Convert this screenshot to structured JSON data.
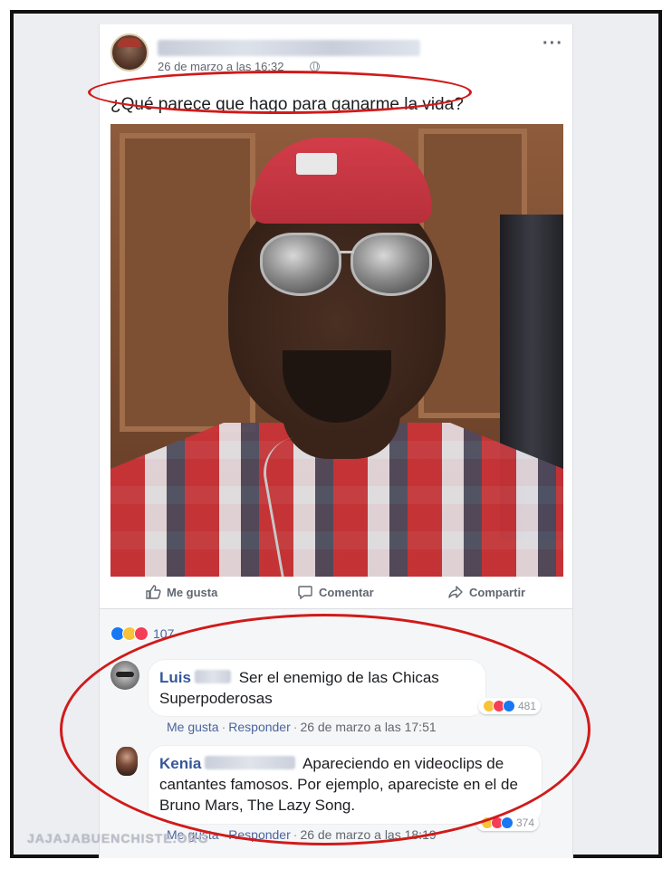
{
  "post": {
    "timestamp": "26 de marzo a las 16:32",
    "text": "¿Qué parece que hago para ganarme la vida?"
  },
  "actions": {
    "like_label": "Me gusta",
    "comment_label": "Comentar",
    "share_label": "Compartir"
  },
  "reactions": {
    "icons": [
      "like-icon",
      "haha-icon",
      "love-icon"
    ],
    "count": "107"
  },
  "comments": [
    {
      "name": "Luis",
      "text": "Ser el enemigo de las Chicas Superpoderosas",
      "like_label": "Me gusta",
      "reply_label": "Responder",
      "time": "26 de marzo a las 17:51",
      "reaction_count": "481"
    },
    {
      "name": "Kenia",
      "text": "Apareciendo en videoclips de cantantes famosos. Por ejemplo, apareciste en el de Bruno Mars, The Lazy Song.",
      "like_label": "Me gusta",
      "reply_label": "Responder",
      "time": "26 de marzo a las 18:19",
      "reaction_count": "374"
    }
  ],
  "watermark": "JAJAJABUENCHISTE.ORG",
  "colors": {
    "annotation": "#d11a1a",
    "link": "#365899",
    "like_blue": "#1877f2"
  }
}
